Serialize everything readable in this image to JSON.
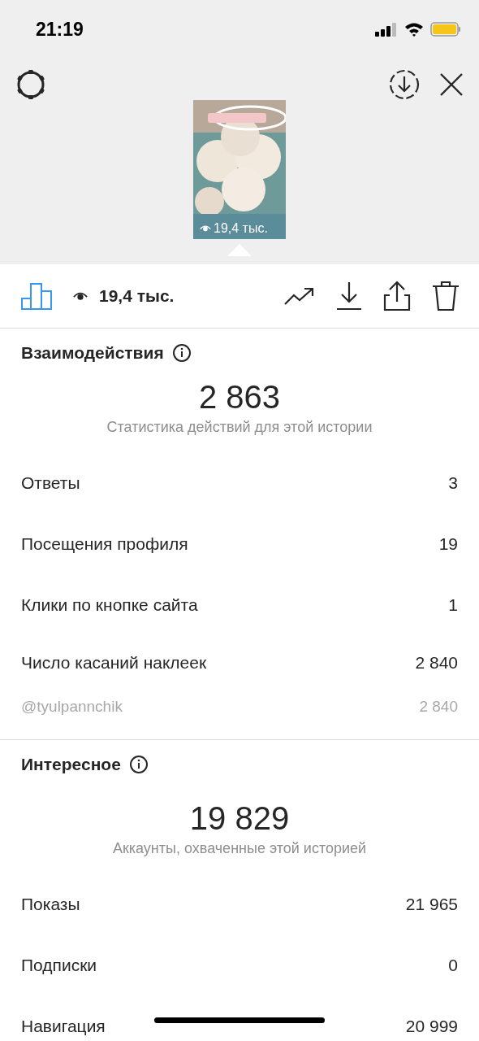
{
  "status_bar": {
    "time": "21:19"
  },
  "story_preview": {
    "kind": "picture",
    "views": "19,4 тыс."
  },
  "toolbar": {
    "views": "19,4 тыс."
  },
  "sections": [
    {
      "title": "Взаимодействия",
      "total": "2 863",
      "caption": "Статистика действий для этой истории",
      "rows": [
        {
          "kind": "metric",
          "label": "Ответы",
          "value": "3"
        },
        {
          "kind": "metric",
          "label": "Посещения профиля",
          "value": "19"
        },
        {
          "kind": "metric",
          "label": "Клики по кнопке сайта",
          "value": "1"
        },
        {
          "kind": "group",
          "label": "Число касаний наклеек",
          "value": "2 840"
        },
        {
          "kind": "sub",
          "label": "@tyulpannchik",
          "value": "2 840"
        }
      ]
    },
    {
      "title": "Интересное",
      "total": "19 829",
      "caption": "Аккаунты, охваченные этой историей",
      "rows": [
        {
          "kind": "metric",
          "label": "Показы",
          "value": "21 965"
        },
        {
          "kind": "metric",
          "label": "Подписки",
          "value": "0"
        },
        {
          "kind": "metric",
          "label": "Навигация",
          "value": "20 999"
        }
      ]
    }
  ]
}
